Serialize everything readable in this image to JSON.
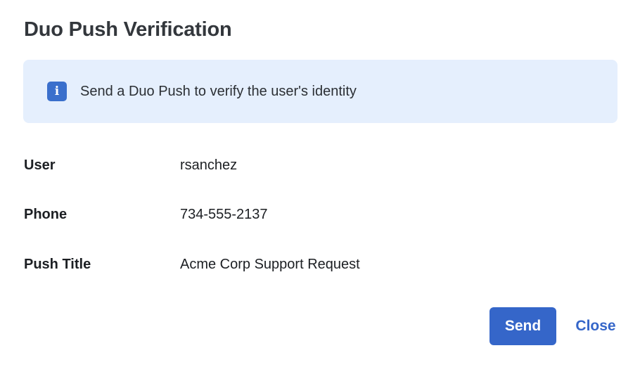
{
  "dialog": {
    "title": "Duo Push Verification",
    "info": {
      "icon": "info-icon",
      "icon_glyph": "i",
      "text": "Send a Duo Push to verify the user's identity",
      "background_color": "#e5effd",
      "icon_color": "#3a6fcc"
    },
    "fields": [
      {
        "label": "User",
        "value": "rsanchez"
      },
      {
        "label": "Phone",
        "value": "734-555-2137"
      },
      {
        "label": "Push Title",
        "value": "Acme Corp Support Request"
      }
    ],
    "actions": {
      "send_label": "Send",
      "close_label": "Close",
      "primary_color": "#3566c9"
    }
  }
}
